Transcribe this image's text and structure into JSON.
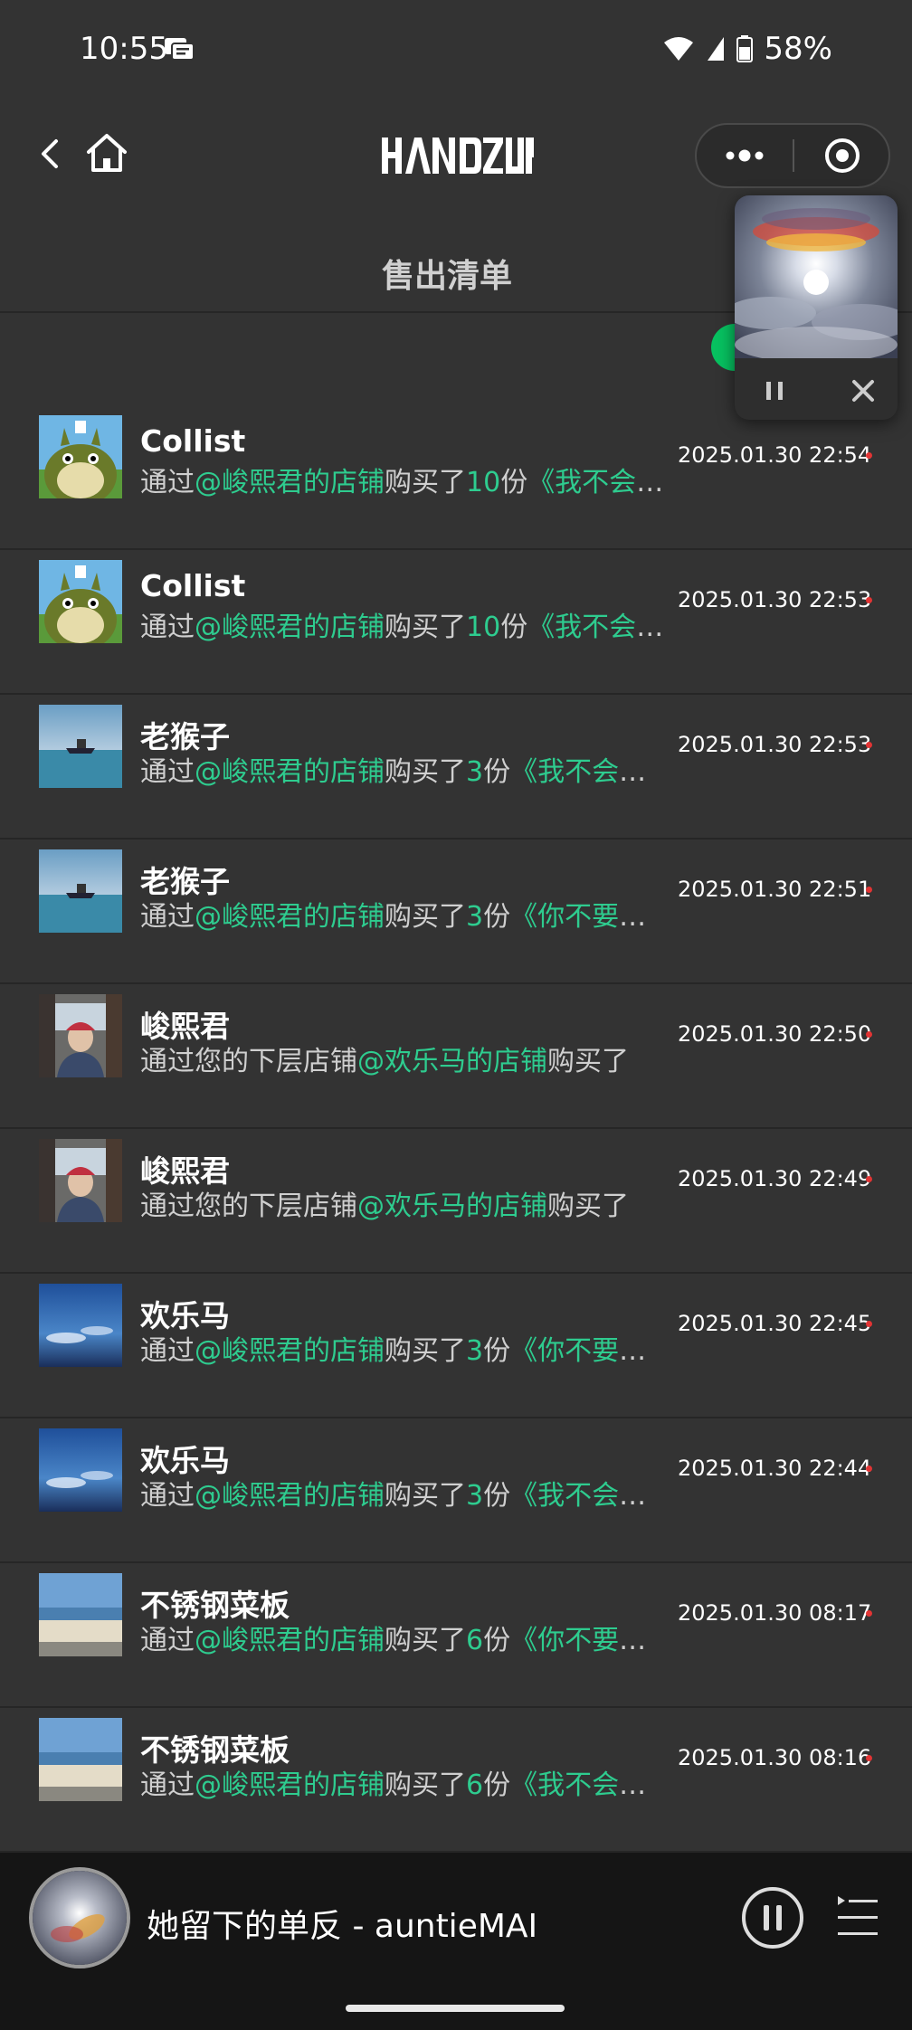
{
  "status_bar": {
    "time": "10:55",
    "battery": "58%"
  },
  "header": {
    "logo_text": "HANDZUP",
    "title": "售出清单"
  },
  "sales": [
    {
      "name": "Collist",
      "pre": "通过",
      "shop": "@峻熙君的店铺",
      "mid": "购买了",
      "qty": "10",
      "unit": "份",
      "item": "《我不会问你"
    },
    {
      "name": "Collist",
      "pre": "通过",
      "shop": "@峻熙君的店铺",
      "mid": "购买了",
      "qty": "10",
      "unit": "份",
      "item": "《我不会问你"
    },
    {
      "name": "老猴子",
      "pre": "通过",
      "shop": "@峻熙君的店铺",
      "mid": "购买了",
      "qty": "3",
      "unit": "份",
      "item": "《我不会问你"
    },
    {
      "name": "老猴子",
      "pre": "通过",
      "shop": "@峻熙君的店铺",
      "mid": "购买了",
      "qty": "3",
      "unit": "份",
      "item": "《你不要再问"
    },
    {
      "name": "峻熙君",
      "pre": "通过您的下层店铺",
      "shop": "@欢乐马的店铺",
      "mid": "购买了",
      "qty": "",
      "unit": "",
      "item": ""
    },
    {
      "name": "峻熙君",
      "pre": "通过您的下层店铺",
      "shop": "@欢乐马的店铺",
      "mid": "购买了",
      "qty": "",
      "unit": "",
      "item": ""
    },
    {
      "name": "欢乐马",
      "pre": "通过",
      "shop": "@峻熙君的店铺",
      "mid": "购买了",
      "qty": "3",
      "unit": "份",
      "item": "《你不要再问"
    },
    {
      "name": "欢乐马",
      "pre": "通过",
      "shop": "@峻熙君的店铺",
      "mid": "购买了",
      "qty": "3",
      "unit": "份",
      "item": "《我不会问你"
    },
    {
      "name": "不锈钢菜板",
      "pre": "通过",
      "shop": "@峻熙君的店铺",
      "mid": "购买了",
      "qty": "6",
      "unit": "份",
      "item": "《你不要再问"
    },
    {
      "name": "不锈钢菜板",
      "pre": "通过",
      "shop": "@峻熙君的店铺",
      "mid": "购买了",
      "qty": "6",
      "unit": "份",
      "item": "《我不会问你"
    }
  ],
  "times": [
    "2025.01.30 22:54",
    "2025.01.30 22:53",
    "2025.01.30 22:53",
    "2025.01.30 22:51",
    "2025.01.30 22:50",
    "2025.01.30 22:49",
    "2025.01.30 22:45",
    "2025.01.30 22:44",
    "2025.01.30 08:17",
    "2025.01.30 08:16"
  ],
  "audio": {
    "title": "她留下的单反 - auntieMAI"
  },
  "colors": {
    "background": "#333333",
    "highlight": "#2ecc8f",
    "unread": "#e23434",
    "accent_green": "#07c160"
  },
  "icons": [
    "message-icon",
    "wifi-icon",
    "signal-icon",
    "battery-icon",
    "back-icon",
    "home-icon",
    "more-icon",
    "target-icon",
    "pause-icon",
    "close-icon",
    "playlist-icon"
  ]
}
